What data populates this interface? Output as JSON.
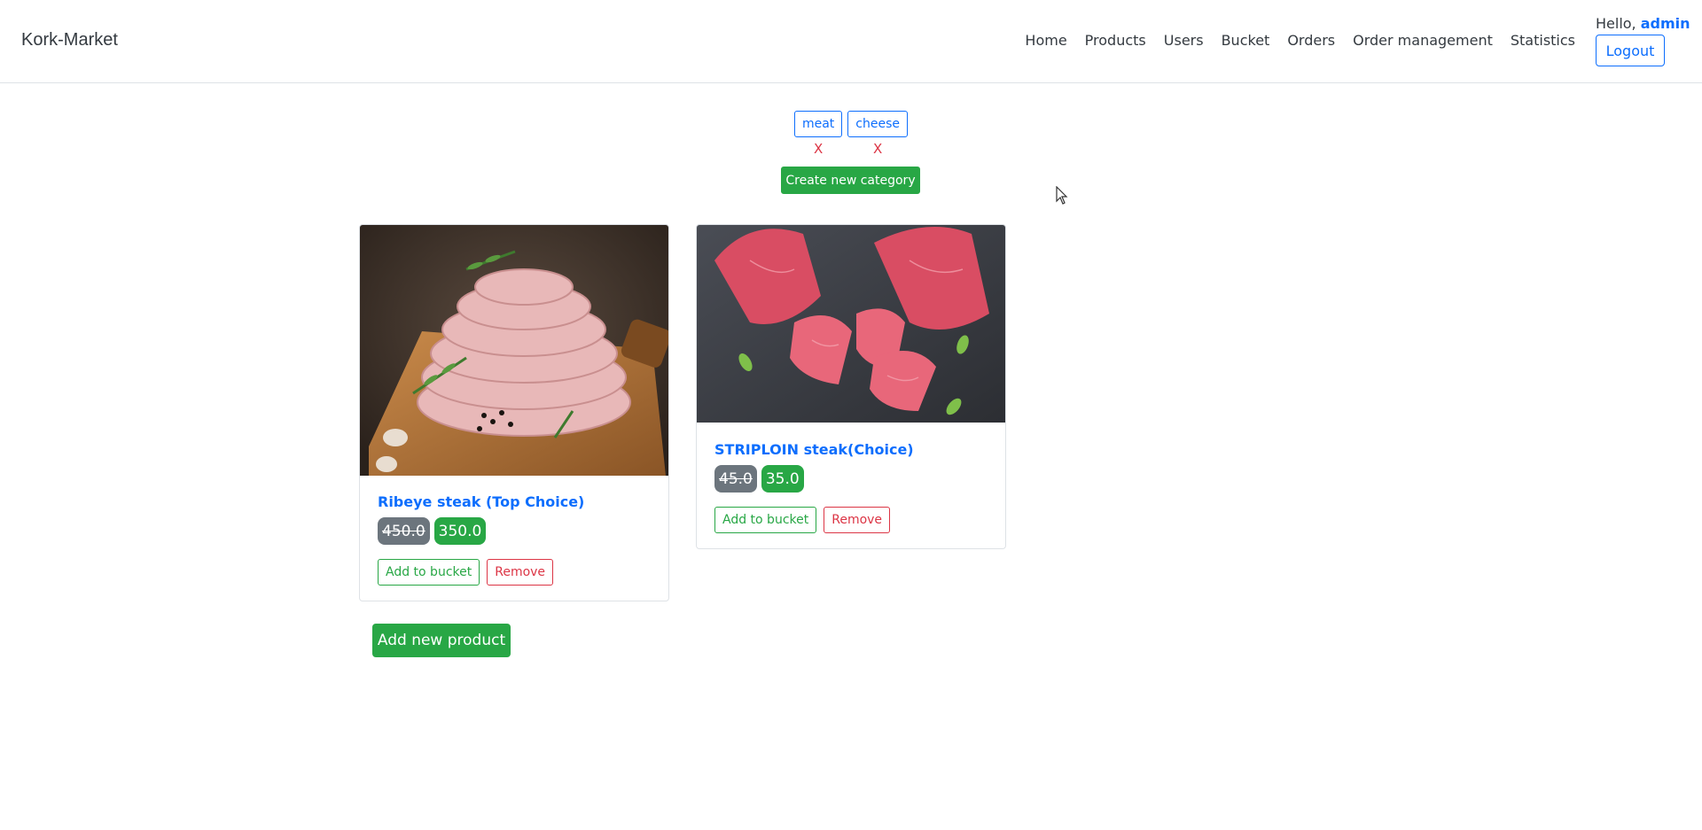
{
  "brand": "Kork-Market",
  "nav": {
    "items": [
      "Home",
      "Products",
      "Users",
      "Bucket",
      "Orders",
      "Order management",
      "Statistics"
    ],
    "hello_prefix": "Hello,",
    "username": "admin",
    "logout_label": "Logout"
  },
  "categories": [
    {
      "name": "meat",
      "remove": "X"
    },
    {
      "name": "cheese",
      "remove": "X"
    }
  ],
  "create_category_label": "Create new category",
  "products": [
    {
      "title": "Ribeye steak (Top Choice)",
      "old_price": "450.0",
      "new_price": "350.0",
      "add_label": "Add to bucket",
      "remove_label": "Remove",
      "image": "sausage-coil-photo"
    },
    {
      "title": "STRIPLOIN steak(Choice)",
      "old_price": "45.0",
      "new_price": "35.0",
      "add_label": "Add to bucket",
      "remove_label": "Remove",
      "image": "raw-tuna-photo"
    }
  ],
  "add_product_label": "Add new product"
}
